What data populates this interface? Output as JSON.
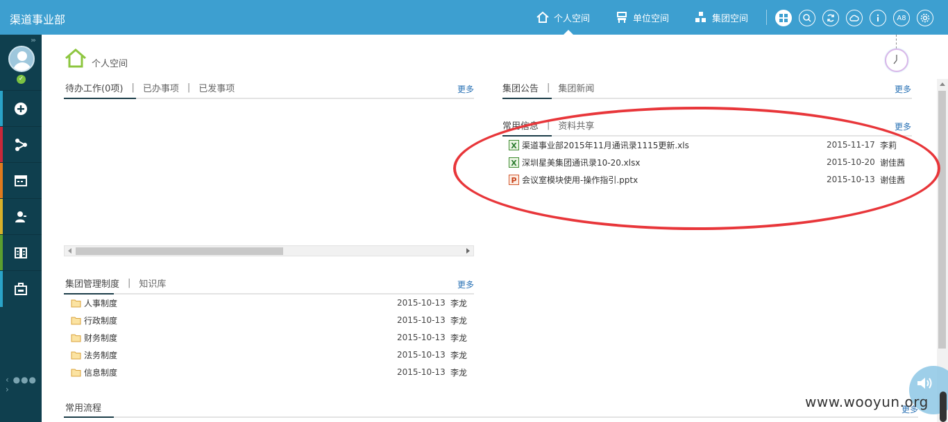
{
  "header": {
    "brand": "渠道事业部",
    "nav": [
      {
        "label": "个人空间"
      },
      {
        "label": "单位空间"
      },
      {
        "label": "集团空间"
      }
    ],
    "tools": [
      "grid-icon",
      "search-icon",
      "refresh-icon",
      "cloud-icon",
      "info-icon",
      "A8",
      "gear-icon"
    ]
  },
  "breadcrumb": {
    "title": "个人空间"
  },
  "todo_panel": {
    "tabs": [
      "待办工作",
      "已办事项",
      "已发事项"
    ],
    "count": "(0项)",
    "more": "更多"
  },
  "notice_panel": {
    "tabs": [
      "集团公告",
      "集团新闻"
    ],
    "more": "更多"
  },
  "docs_panel": {
    "tabs": [
      "常用信息",
      "资料共享"
    ],
    "more": "更多",
    "items": [
      {
        "icon": "excel-icon",
        "name": "渠道事业部2015年11月通讯录1115更新.xls",
        "date": "2015-11-17",
        "author": "李莉"
      },
      {
        "icon": "excel-icon",
        "name": "深圳星美集团通讯录10-20.xlsx",
        "date": "2015-10-20",
        "author": "谢佳茜"
      },
      {
        "icon": "powerpoint-icon",
        "name": "会议室模块使用-操作指引.pptx",
        "date": "2015-10-13",
        "author": "谢佳茜"
      }
    ]
  },
  "rules_panel": {
    "tabs": [
      "集团管理制度",
      "知识库"
    ],
    "more": "更多",
    "items": [
      {
        "name": "人事制度",
        "date": "2015-10-13",
        "author": "李龙"
      },
      {
        "name": "行政制度",
        "date": "2015-10-13",
        "author": "李龙"
      },
      {
        "name": "财务制度",
        "date": "2015-10-13",
        "author": "李龙"
      },
      {
        "name": "法务制度",
        "date": "2015-10-13",
        "author": "李龙"
      },
      {
        "name": "信息制度",
        "date": "2015-10-13",
        "author": "李龙"
      }
    ]
  },
  "flow_panel": {
    "tabs": [
      "常用流程"
    ],
    "more": "更多"
  },
  "watermark": "www.wooyun.org",
  "colors": {
    "topbar": "#3d9fd0",
    "sidebar": "#0f3f4e",
    "link": "#2a72b5",
    "annotation": "#e8363a"
  }
}
